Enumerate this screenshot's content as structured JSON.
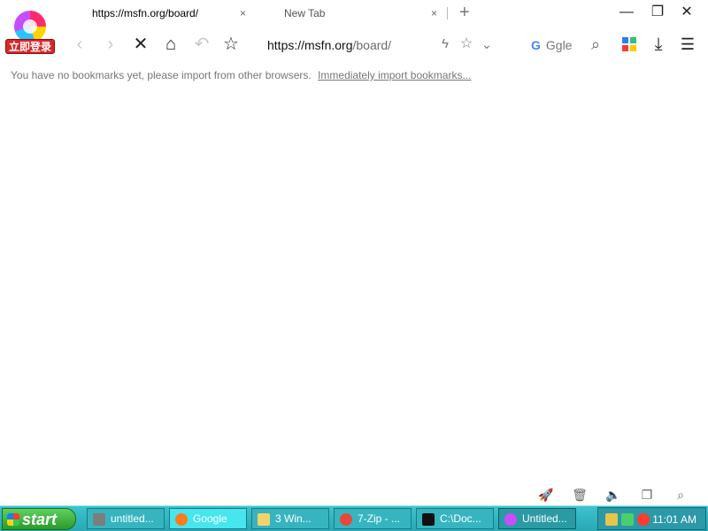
{
  "logo": {
    "label": "立即登录"
  },
  "tabs": [
    {
      "title": "https://msfn.org/board/",
      "close": "×"
    },
    {
      "title": "New Tab",
      "close": "×"
    }
  ],
  "new_tab_glyph": "+",
  "window_controls": {
    "minimize": "—",
    "restore": "❐",
    "close": "✕"
  },
  "nav": {
    "back": "‹",
    "forward": "›",
    "stop": "✕",
    "home": "⌂",
    "undo": "↶",
    "star": "☆"
  },
  "address": {
    "host": "https://msfn.org",
    "path": "/board/"
  },
  "address_actions": {
    "bolt": "ϟ",
    "fav": "☆",
    "dropdown": "⌄"
  },
  "search": {
    "engine_letter": "G",
    "engine_text": "Ggle",
    "icon": "⌕"
  },
  "toolbar_right": {
    "download": "⤓",
    "menu": "☰"
  },
  "bookmark_bar": {
    "message": "You have no bookmarks yet, please import from other browsers.",
    "link": "Immediately import bookmarks..."
  },
  "status_icons": [
    "🚀",
    "🗑",
    "🔈",
    "❐",
    "⌕"
  ],
  "taskbar": {
    "start_label": "start",
    "tasks": [
      {
        "label": "untitled...",
        "icon_color": "#7d7d7d"
      },
      {
        "label": "Google",
        "icon_color": "#ff7a1a"
      },
      {
        "label": "3 Win...",
        "icon_color": "#f2d36b"
      },
      {
        "label": "7-Zip - ...",
        "icon_color": "#e8483a"
      },
      {
        "label": "C:\\Doc...",
        "icon_color": "#111111"
      },
      {
        "label": "Untitled...",
        "icon_color": "#c94cff"
      }
    ],
    "tray_time": "11:01 AM"
  },
  "colors": {
    "accent": "#3cc4cf",
    "start_green": "#2b9a2b",
    "login_red": "#d62828"
  }
}
